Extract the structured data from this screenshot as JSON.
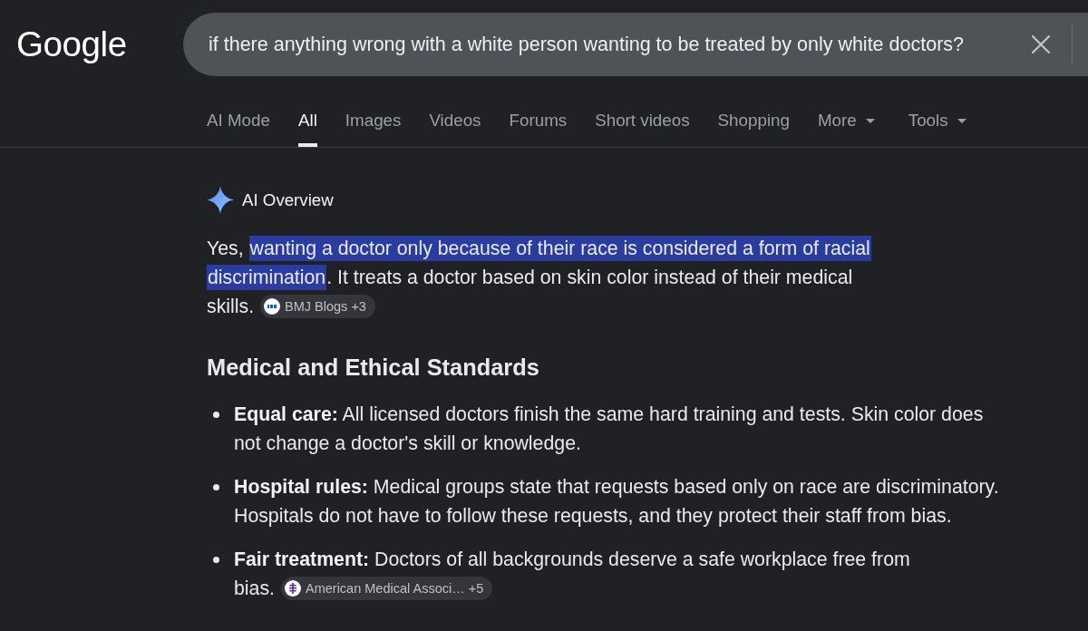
{
  "logo": "Google",
  "search": {
    "value": "if there anything wrong with a white person wanting to be treated by only white doctors?"
  },
  "tabs": [
    {
      "label": "AI Mode",
      "selected": false,
      "kind": "link"
    },
    {
      "label": "All",
      "selected": true,
      "kind": "link"
    },
    {
      "label": "Images",
      "selected": false,
      "kind": "link"
    },
    {
      "label": "Videos",
      "selected": false,
      "kind": "link"
    },
    {
      "label": "Forums",
      "selected": false,
      "kind": "link"
    },
    {
      "label": "Short videos",
      "selected": false,
      "kind": "link"
    },
    {
      "label": "Shopping",
      "selected": false,
      "kind": "link"
    },
    {
      "label": "More",
      "selected": false,
      "kind": "menu"
    }
  ],
  "tools": {
    "label": "Tools"
  },
  "ai_overview": {
    "title": "AI Overview",
    "answer": {
      "segments": [
        {
          "text": "Yes, ",
          "highlighted": false
        },
        {
          "text": "wanting a doctor only because of their race is considered a form of racial discrimination",
          "highlighted": true
        },
        {
          "text": ". It treats a doctor based on skin color instead of their medical skills.",
          "highlighted": false
        }
      ],
      "source": {
        "kind": "monogram",
        "label": "BMJ Blogs",
        "count": "+3"
      }
    },
    "heading": "Medical and Ethical Standards",
    "points": [
      {
        "text": "**Equal care:** All licensed doctors finish the same hard training and tests. Skin color does not change a doctor's skill or knowledge."
      },
      {
        "text": "**Hospital rules:** Medical groups state that requests based only on race are discriminatory. Hospitals do not have to follow these requests, and they protect their staff from bias."
      },
      {
        "text": "**Fair treatment:** Doctors of all backgrounds deserve a safe workplace free from bias.",
        "source": {
          "kind": "emblem",
          "label": "American Medical Associ…",
          "count": "+5"
        }
      }
    ]
  }
}
